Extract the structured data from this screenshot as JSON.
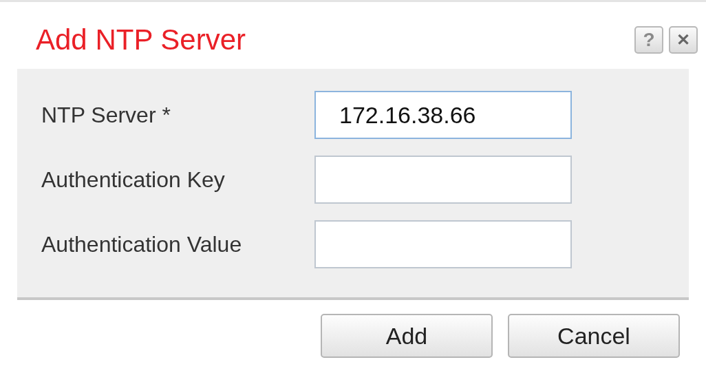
{
  "dialog": {
    "title": "Add NTP Server",
    "title_buttons": [
      {
        "kind": "help",
        "label": "?"
      },
      {
        "kind": "close",
        "label": "✕"
      }
    ]
  },
  "fields": [
    {
      "label": "NTP Server *",
      "value": "172.16.38.66",
      "focused": true
    },
    {
      "label": "Authentication Key",
      "focused": false
    },
    {
      "label": "Authentication Value",
      "focused": false
    }
  ],
  "buttons": [
    "Add",
    "Cancel"
  ]
}
